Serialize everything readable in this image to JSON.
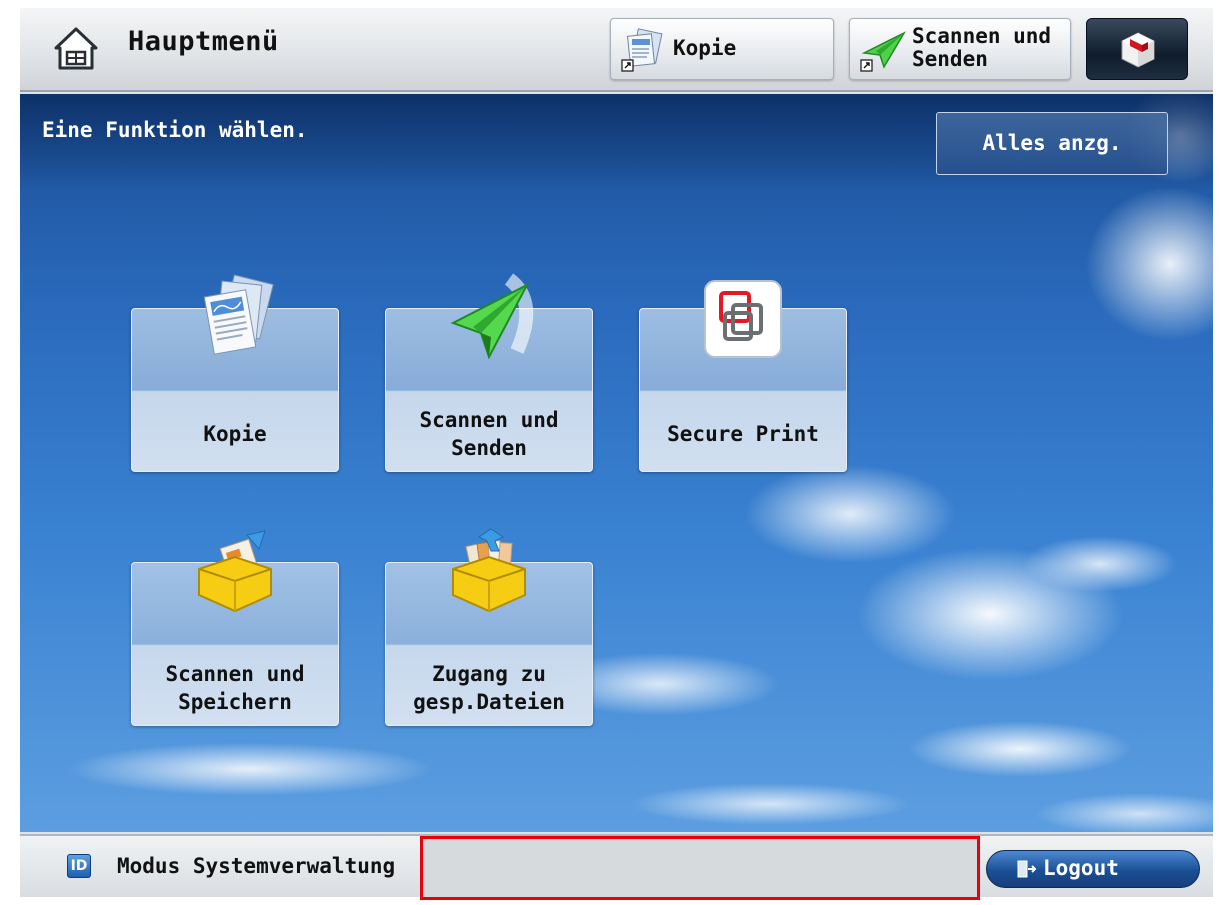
{
  "header": {
    "title": "Hauptmenü",
    "shortcuts": [
      {
        "label": "Kopie",
        "icon": "copy-doc-icon"
      },
      {
        "label": "Scannen und\nSenden",
        "icon": "paper-plane-icon"
      }
    ],
    "status_icon": "status-monitor-icon"
  },
  "main": {
    "instruction": "Eine Funktion wählen.",
    "show_all_label": "Alles anzg.",
    "tiles": [
      {
        "label": "Kopie",
        "icon": "copy-doc-icon"
      },
      {
        "label": "Scannen und\nSenden",
        "icon": "paper-plane-icon"
      },
      {
        "label": "Secure Print",
        "icon": "secure-print-icon"
      },
      {
        "label": "Scannen und\nSpeichern",
        "icon": "scan-store-box-icon"
      },
      {
        "label": "Zugang zu\ngesp.Dateien",
        "icon": "stored-files-box-icon"
      }
    ]
  },
  "footer": {
    "id_badge": "ID",
    "mode_text": "Modus Systemverwaltung",
    "message": "",
    "logout_label": "Logout"
  },
  "colors": {
    "highlight_border": "#e8000b",
    "sky_top": "#1a4f97",
    "logout_blue": "#1a4f95"
  }
}
